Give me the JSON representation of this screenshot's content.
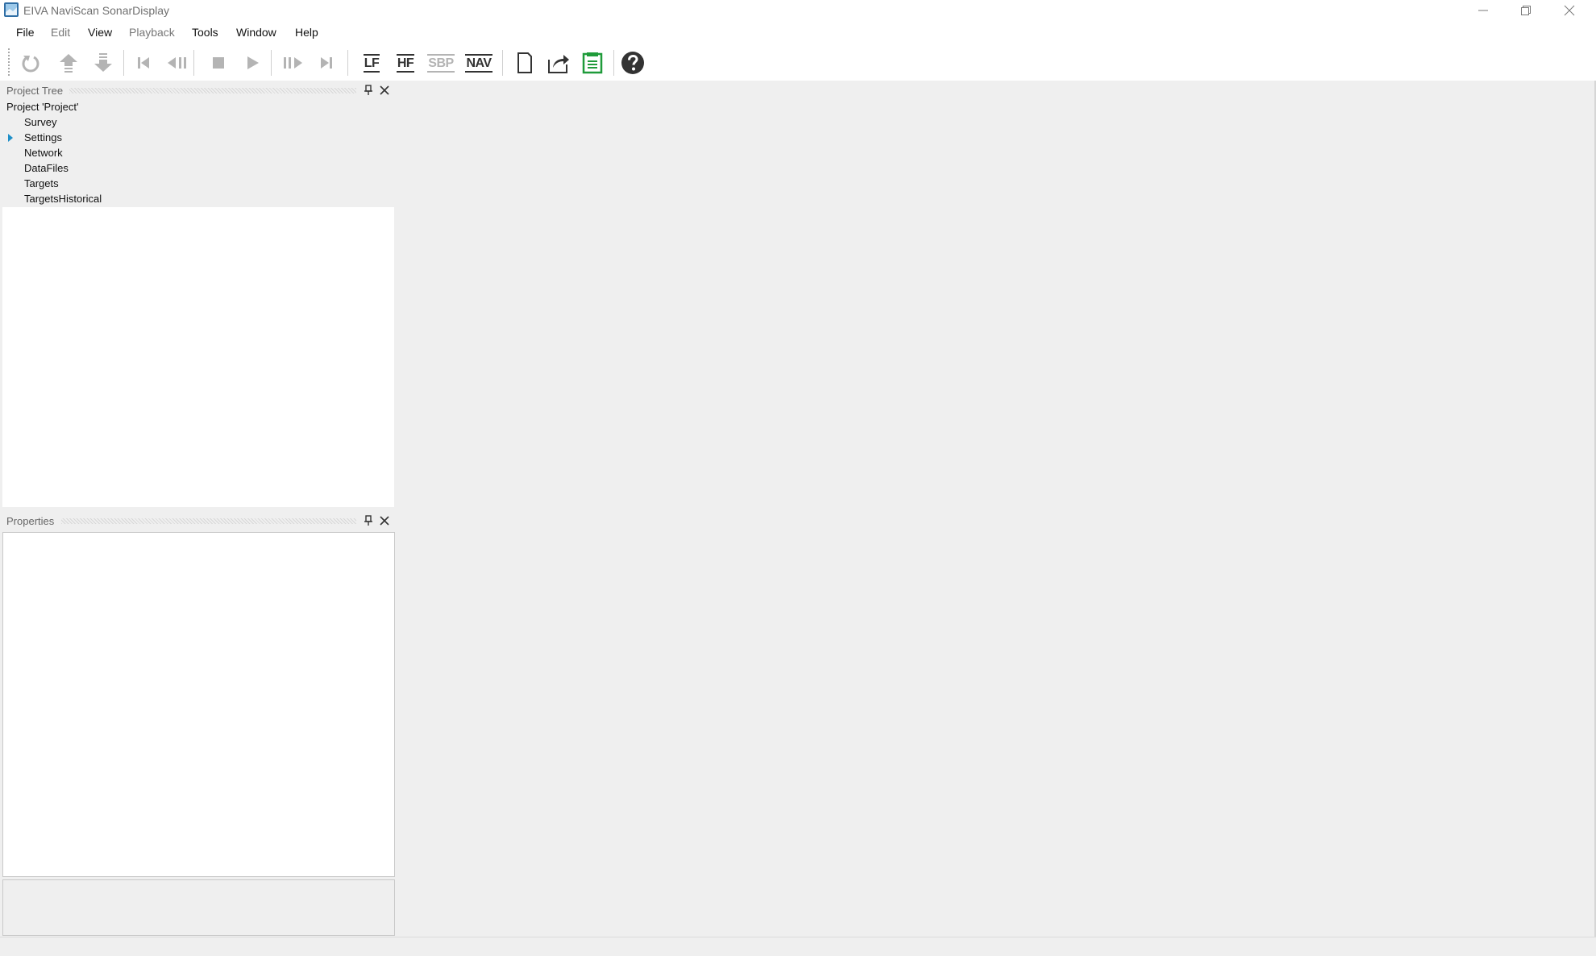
{
  "window": {
    "title": "EIVA NaviScan SonarDisplay"
  },
  "menu": [
    {
      "label": "File",
      "enabled": true
    },
    {
      "label": "Edit",
      "enabled": false
    },
    {
      "label": "View",
      "enabled": true
    },
    {
      "label": "Playback",
      "enabled": false
    },
    {
      "label": "Tools",
      "enabled": true
    },
    {
      "label": "Window",
      "enabled": true
    },
    {
      "label": "Help",
      "enabled": true
    }
  ],
  "toolbar": {
    "lf_label": "LF",
    "hf_label": "HF",
    "sbp_label": "SBP",
    "nav_label": "NAV",
    "icons": [
      "refresh-icon",
      "move-up-icon",
      "move-down-icon",
      "skip-first-icon",
      "step-back-icon",
      "stop-icon",
      "play-icon",
      "step-forward-icon",
      "skip-last-icon",
      "lf-icon",
      "hf-icon",
      "sbp-icon",
      "nav-icon",
      "new-document-icon",
      "export-icon",
      "save-icon",
      "help-icon"
    ],
    "colors": {
      "active": "#333333",
      "disabled": "#b4b4b4",
      "save": "#1f9b3a"
    }
  },
  "project_tree": {
    "title": "Project Tree",
    "root": "Project 'Project'",
    "items": [
      "Survey",
      "Settings",
      "Network",
      "DataFiles",
      "Targets",
      "TargetsHistorical"
    ]
  },
  "properties": {
    "title": "Properties"
  }
}
